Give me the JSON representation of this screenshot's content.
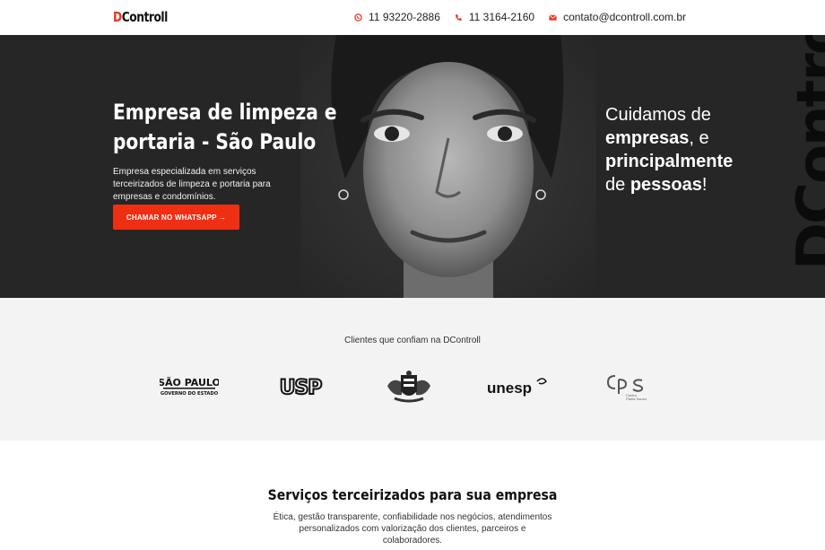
{
  "header": {
    "logo_mark": "D",
    "logo_text": "Controll",
    "contacts": [
      {
        "icon": "whatsapp-icon",
        "text": "11 93220-2886"
      },
      {
        "icon": "phone-icon",
        "text": "11 3164-2160"
      },
      {
        "icon": "envelope-icon",
        "text": "contato@dcontroll.com.br"
      }
    ]
  },
  "hero": {
    "title_line1": "Empresa de limpeza e",
    "title_line2": "portaria - São Paulo",
    "subtitle": "Empresa especializada em serviços terceirizados de limpeza e portaria para empresas e condomínios.",
    "cta_label": "CHAMAR NO WHATSAPP →",
    "tagline": {
      "line1": "Cuidamos de",
      "line2_bold": "empresas",
      "line2_rest": ", e",
      "line3_bold": "principalmente",
      "line4_pre": "de ",
      "line4_bold": "pessoas",
      "line4_rest": "!"
    },
    "side_text": "DControll"
  },
  "clients": {
    "title": "Clientes que confiam na DControll",
    "logos": [
      {
        "name": "sao-paulo-governo",
        "line1": "SÃO PAULO",
        "line2": "GOVERNO DO ESTADO"
      },
      {
        "name": "usp",
        "text": "USP"
      },
      {
        "name": "brasao-sp",
        "text": ""
      },
      {
        "name": "unesp",
        "text": "unesp"
      },
      {
        "name": "cps",
        "text": "CPS",
        "sub1": "Centro",
        "sub2": "Paula Souza"
      }
    ]
  },
  "services": {
    "title": "Serviços terceirizados para sua empresa",
    "description": "Ética, gestão transparente, confiabilidade nos negócios, atendimentos personalizados com valorização dos clientes, parceiros e colaboradores."
  },
  "colors": {
    "accent": "#ef2f13",
    "hero_bg": "#262626",
    "clients_bg": "#f3f3f3"
  }
}
